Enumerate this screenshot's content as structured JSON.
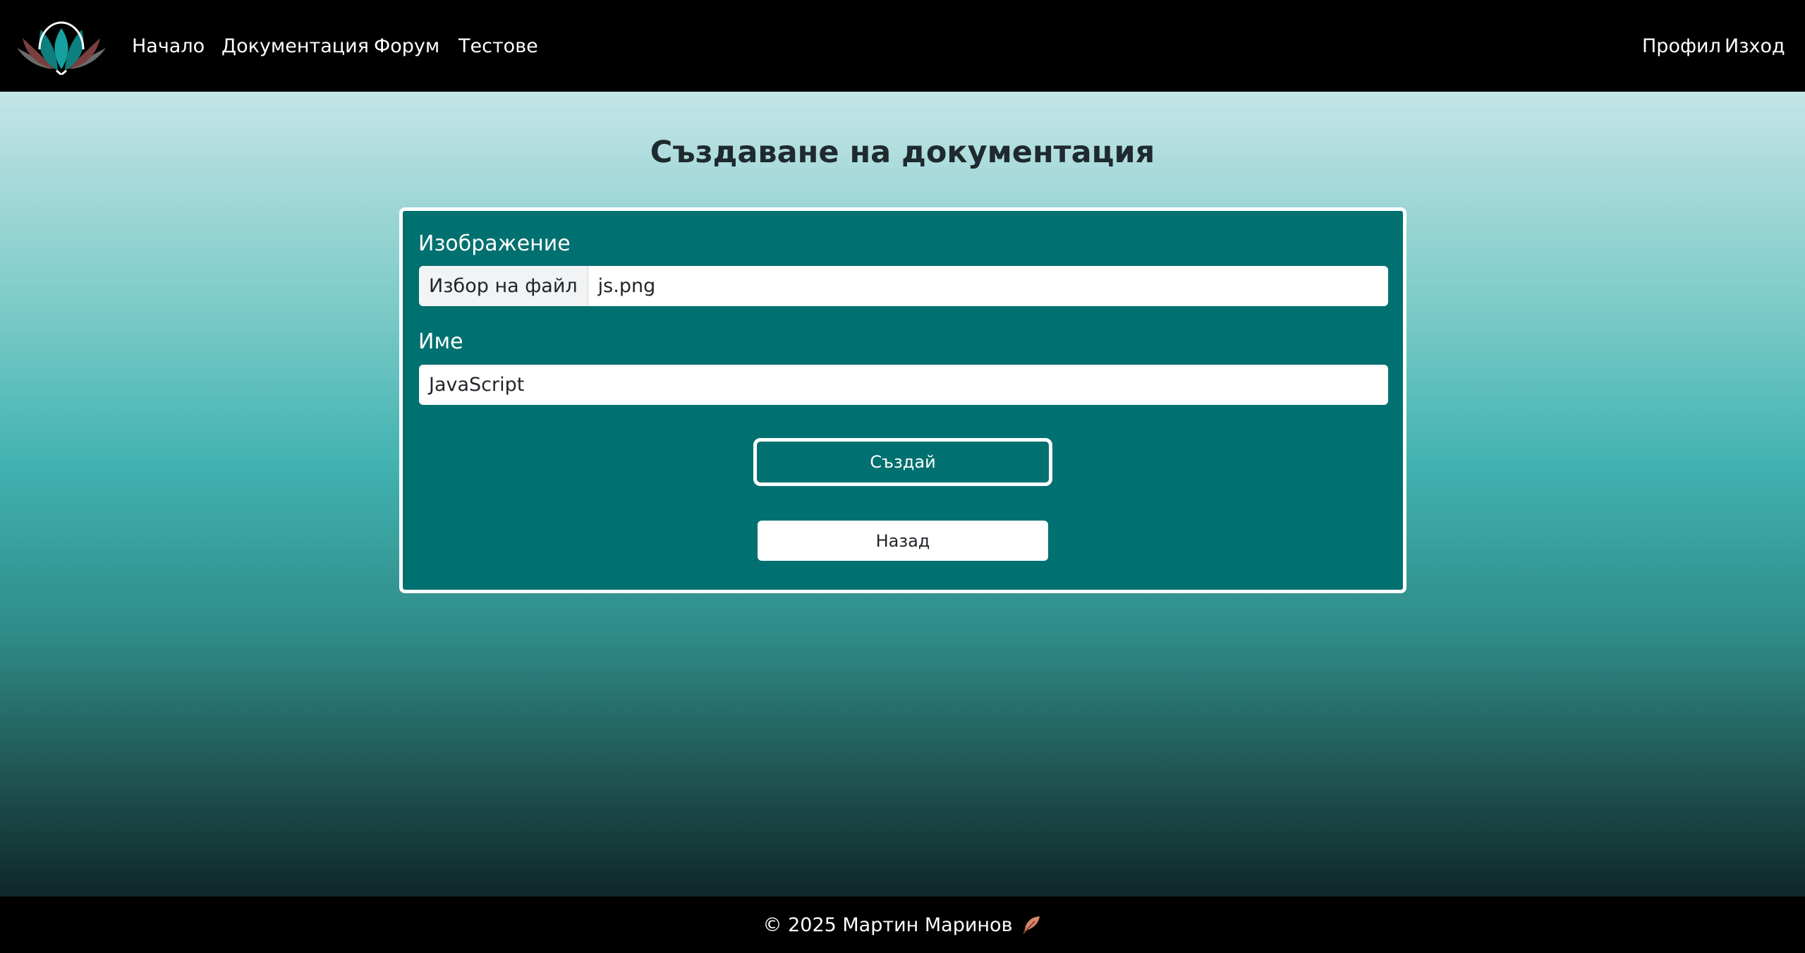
{
  "nav": {
    "logo_icon": "lotus-logo-icon",
    "links": [
      {
        "label": "Начало"
      },
      {
        "label": "Документация"
      },
      {
        "label": "Форум"
      },
      {
        "label": "Тестове"
      }
    ],
    "right_links": [
      {
        "label": "Профил"
      },
      {
        "label": "Изход"
      }
    ]
  },
  "main": {
    "title": "Създаване на документация",
    "form": {
      "image_label": "Изображение",
      "file_button_label": "Избор на файл",
      "file_name": "js.png",
      "name_label": "Име",
      "name_value": "JavaScript",
      "create_label": "Създай",
      "back_label": "Назад"
    }
  },
  "footer": {
    "text": "© 2025 Мартин Маринов",
    "icon": "feather-icon"
  },
  "colors": {
    "navbar": "#000000",
    "card": "#017070",
    "accent_teal": "#41b2b0",
    "text_dark": "#1e2a2e",
    "white": "#ffffff"
  }
}
